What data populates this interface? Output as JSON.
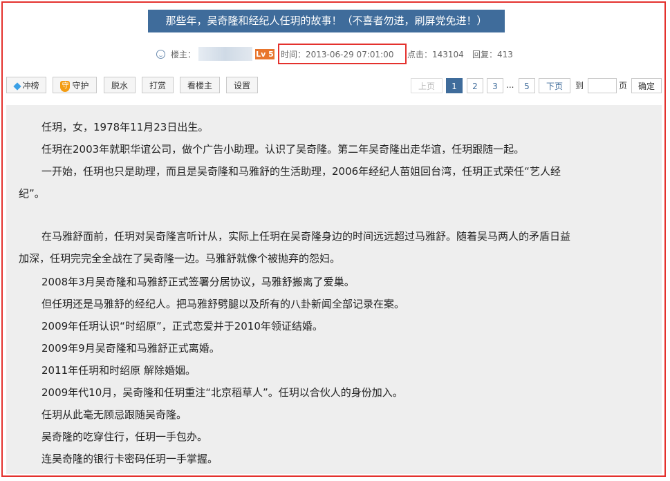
{
  "header": {
    "title": "那些年，吴奇隆和经纪人任玥的故事！（不喜者勿进，刷屏党免进！）",
    "louzhu_label": "楼主：",
    "level_badge": "Lv 5",
    "time": "时间：2013-06-29 07:01:00",
    "clicks": "点击：143104",
    "replies": "回复：413"
  },
  "toolbar": {
    "chongbang": "冲榜",
    "shouhu": "守护",
    "shouhu_glyph": "守",
    "tuoshui": "脱水",
    "dashang": "打赏",
    "kanlouzhu": "看楼主",
    "shezhi": "设置"
  },
  "pagination": {
    "prev": "上页",
    "pages": [
      "1",
      "2",
      "3"
    ],
    "dots": "...",
    "last": "5",
    "next": "下页",
    "to_label": "到",
    "page_label": "页",
    "jump_value": "",
    "confirm": "确定"
  },
  "content": {
    "lines": [
      "任玥，女，1978年11月23日出生。",
      "任玥在2003年就职华谊公司，做个广告小助理。认识了吴奇隆。第二年吴奇隆出走华谊，任玥跟随一起。",
      "一开始，任玥也只是助理，而且是吴奇隆和马雅舒的生活助理，2006年经纪人苗姐回台湾，任玥正式荣任“艺人经",
      "纪”。",
      "在马雅舒面前，任玥对吴奇隆言听计从，实际上任玥在吴奇隆身边的时间远远超过马雅舒。随着吴马两人的矛盾日益",
      "加深，任玥完完全全战在了吴奇隆一边。马雅舒就像个被抛弃的怨妇。",
      "2008年3月吴奇隆和马雅舒正式签署分居协议，马雅舒搬离了爱巢。",
      "但任玥还是马雅舒的经纪人。把马雅舒劈腿以及所有的八卦新闻全部记录在案。",
      "2009年任玥认识“时绍原”，正式恋爱并于2010年领证结婚。",
      "2009年9月吴奇隆和马雅舒正式离婚。",
      "2011年任玥和时绍原 解除婚姻。",
      "2009年代10月，吴奇隆和任玥重注“北京稻草人”。任玥以合伙人的身份加入。",
      "任玥从此毫无顾忌跟随吴奇隆。",
      "吴奇隆的吃穿住行，任玥一手包办。",
      "连吴奇隆的银行卡密码任玥一手掌握。"
    ]
  },
  "colors": {
    "accent": "#3f6c9b",
    "highlight_border": "#e4312d",
    "level_badge": "#e8752d",
    "content_bg": "#eeeeee"
  }
}
